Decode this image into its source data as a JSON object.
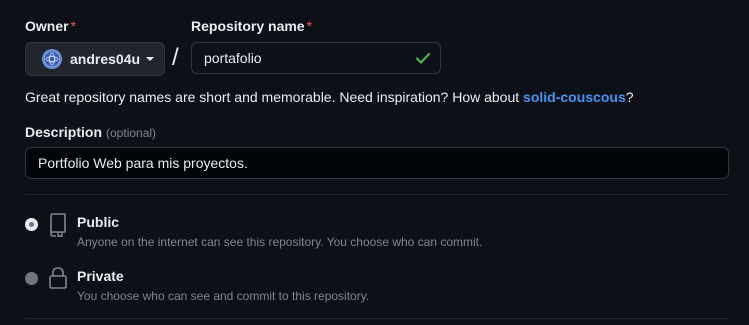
{
  "owner": {
    "label": "Owner",
    "required_mark": "*",
    "value": "andres04u"
  },
  "repository_name": {
    "label": "Repository name",
    "required_mark": "*",
    "value": "portafolio",
    "separator": "/"
  },
  "hint": {
    "text": "Great repository names are short and memorable. Need inspiration? How about ",
    "suggestion": "solid-couscous",
    "suffix": "?"
  },
  "description": {
    "label": "Description",
    "optional": "(optional)",
    "value": "Portfolio Web para mis proyectos."
  },
  "visibility": {
    "options": [
      {
        "title": "Public",
        "description": "Anyone on the internet can see this repository. You choose who can commit.",
        "selected": true,
        "icon": "repo-icon"
      },
      {
        "title": "Private",
        "description": "You choose who can see and commit to this repository.",
        "selected": false,
        "icon": "lock-icon"
      }
    ]
  },
  "colors": {
    "background": "#0d1117",
    "link": "#4493f8",
    "success": "#3fb950",
    "required": "#f85149"
  }
}
